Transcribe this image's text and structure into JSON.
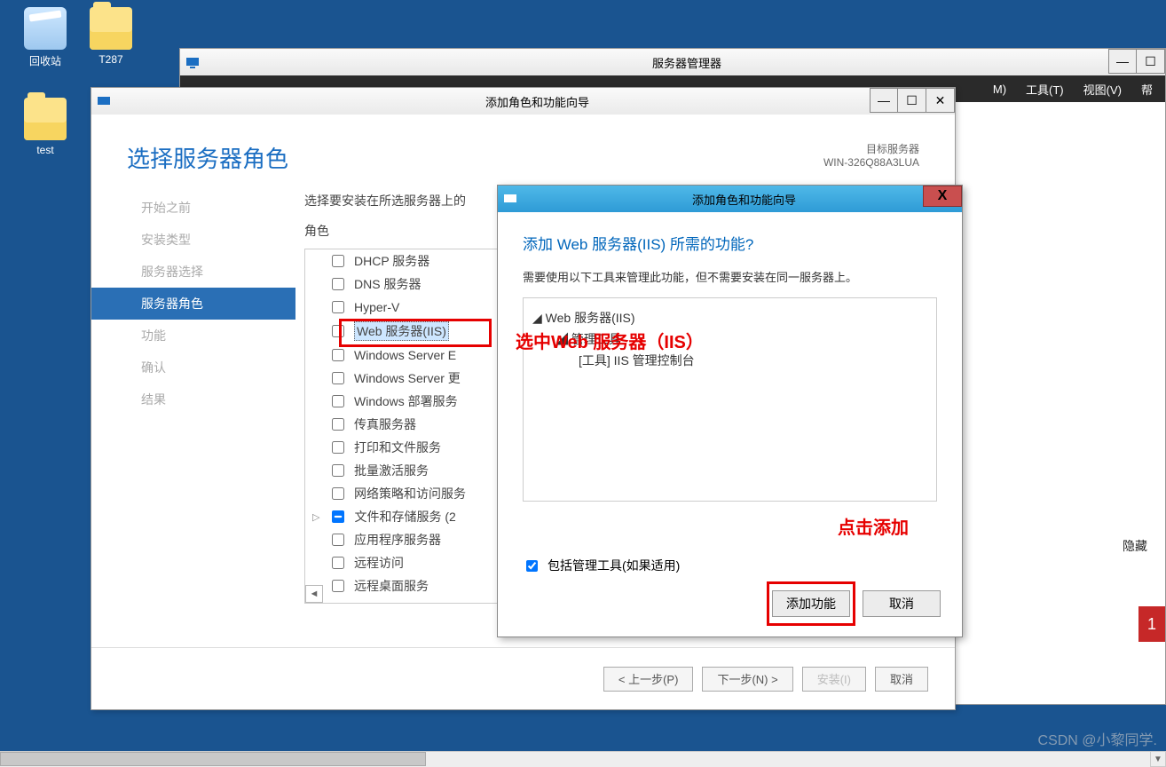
{
  "desktop": {
    "recycle": "回收站",
    "folder1": "T287",
    "folder2": "test"
  },
  "srvmgr": {
    "title": "服务器管理器",
    "menu": {
      "m": "M)",
      "tools": "工具(T)",
      "view": "视图(V)",
      "help": "帮"
    },
    "hidden": "隐藏",
    "badge": "1"
  },
  "wizard": {
    "title": "添加角色和功能向导",
    "heading": "选择服务器角色",
    "target_label": "目标服务器",
    "target_value": "WIN-326Q88A3LUA",
    "nav": [
      "开始之前",
      "安装类型",
      "服务器选择",
      "服务器角色",
      "功能",
      "确认",
      "结果"
    ],
    "nav_active": 3,
    "prompt": "选择要安装在所选服务器上的",
    "roles_label": "角色",
    "roles": [
      "DHCP 服务器",
      "DNS 服务器",
      "Hyper-V",
      "Web 服务器(IIS)",
      "Windows Server E",
      "Windows Server 更",
      "Windows 部署服务",
      "传真服务器",
      "打印和文件服务",
      "批量激活服务",
      "网络策略和访问服务",
      "文件和存储服务 (2",
      "应用程序服务器",
      "远程访问",
      "远程桌面服务"
    ],
    "highlight_index": 3,
    "footer": {
      "prev": "< 上一步(P)",
      "next": "下一步(N) >",
      "install": "安装(I)",
      "cancel": "取消"
    }
  },
  "popup": {
    "title": "添加角色和功能向导",
    "question": "添加 Web 服务器(IIS) 所需的功能?",
    "desc": "需要使用以下工具来管理此功能，但不需要安装在同一服务器上。",
    "tree": {
      "root": "Web 服务器(IIS)",
      "child": "管理工具",
      "leaf": "[工具] IIS 管理控制台"
    },
    "include_tools": "包括管理工具(如果适用)",
    "add": "添加功能",
    "cancel": "取消"
  },
  "annotations": {
    "select_iis": "选中Web 服务器（IIS）",
    "click_add": "点击添加"
  },
  "watermark": "CSDN @小黎同学."
}
